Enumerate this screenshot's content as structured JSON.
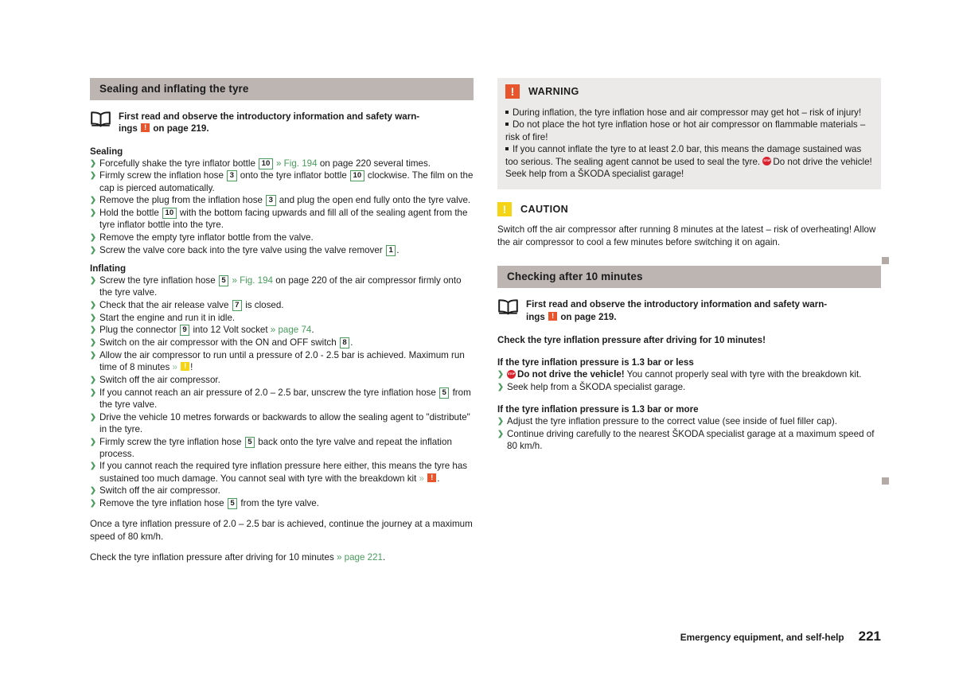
{
  "left_column": {
    "section_title": "Sealing and inflating the tyre",
    "read_first": {
      "line1": "First read and observe the introductory information and safety warn-",
      "line2_a": "ings",
      "line2_b": "on page 219."
    },
    "sealing": {
      "heading": "Sealing",
      "steps": [
        {
          "parts": [
            {
              "t": "text",
              "v": "Forcefully shake the tyre inflator bottle "
            },
            {
              "t": "numbox",
              "v": "10"
            },
            {
              "t": "xref",
              "v": "» Fig. 194"
            },
            {
              "t": "text",
              "v": " on page 220 several times."
            }
          ]
        },
        {
          "parts": [
            {
              "t": "text",
              "v": "Firmly screw the inflation hose "
            },
            {
              "t": "numbox",
              "v": "3"
            },
            {
              "t": "text",
              "v": " onto the tyre inflator bottle "
            },
            {
              "t": "numbox",
              "v": "10"
            },
            {
              "t": "text",
              "v": " clockwise. The film on the cap is pierced automatically."
            }
          ]
        },
        {
          "parts": [
            {
              "t": "text",
              "v": "Remove the plug from the inflation hose "
            },
            {
              "t": "numbox",
              "v": "3"
            },
            {
              "t": "text",
              "v": " and plug the open end fully onto the tyre valve."
            }
          ]
        },
        {
          "parts": [
            {
              "t": "text",
              "v": "Hold the bottle "
            },
            {
              "t": "numbox",
              "v": "10"
            },
            {
              "t": "text",
              "v": " with the bottom facing upwards and fill all of the sealing agent from the tyre inflator bottle into the tyre."
            }
          ]
        },
        {
          "parts": [
            {
              "t": "text",
              "v": "Remove the empty tyre inflator bottle from the valve."
            }
          ]
        },
        {
          "parts": [
            {
              "t": "text",
              "v": "Screw the valve core back into the tyre valve using the valve remover "
            },
            {
              "t": "numbox",
              "v": "1"
            },
            {
              "t": "text",
              "v": "."
            }
          ]
        }
      ]
    },
    "inflating": {
      "heading": "Inflating",
      "steps": [
        {
          "parts": [
            {
              "t": "text",
              "v": "Screw the tyre inflation hose "
            },
            {
              "t": "numbox",
              "v": "5"
            },
            {
              "t": "xref",
              "v": "» Fig. 194"
            },
            {
              "t": "text",
              "v": " on page 220 of the air compressor firmly onto the tyre valve."
            }
          ]
        },
        {
          "parts": [
            {
              "t": "text",
              "v": "Check that the air release valve "
            },
            {
              "t": "numbox",
              "v": "7"
            },
            {
              "t": "text",
              "v": " is closed."
            }
          ]
        },
        {
          "parts": [
            {
              "t": "text",
              "v": "Start the engine and run it in idle."
            }
          ]
        },
        {
          "parts": [
            {
              "t": "text",
              "v": "Plug the connector "
            },
            {
              "t": "numbox",
              "v": "9"
            },
            {
              "t": "text",
              "v": " into 12 Volt socket "
            },
            {
              "t": "xref",
              "v": "» page 74"
            },
            {
              "t": "text",
              "v": "."
            }
          ]
        },
        {
          "parts": [
            {
              "t": "text",
              "v": "Switch on the air compressor with the ON and OFF switch "
            },
            {
              "t": "numbox",
              "v": "8"
            },
            {
              "t": "text",
              "v": "."
            }
          ]
        },
        {
          "parts": [
            {
              "t": "text",
              "v": "Allow the air compressor to run until a pressure of 2.0 - 2.5 bar is achieved. Maximum run time of 8 minutes "
            },
            {
              "t": "xref-arrow",
              "v": "»"
            },
            {
              "t": "glyph-caution"
            },
            {
              "t": "text",
              "v": "!"
            }
          ]
        },
        {
          "parts": [
            {
              "t": "text",
              "v": "Switch off the air compressor."
            }
          ]
        },
        {
          "parts": [
            {
              "t": "text",
              "v": "If you cannot reach an air pressure of 2.0 – 2.5 bar, unscrew the tyre inflation hose "
            },
            {
              "t": "numbox",
              "v": "5"
            },
            {
              "t": "text",
              "v": " from the tyre valve."
            }
          ]
        },
        {
          "parts": [
            {
              "t": "text",
              "v": "Drive the vehicle 10 metres forwards or backwards to allow the sealing agent to \"distribute\" in the tyre."
            }
          ]
        },
        {
          "parts": [
            {
              "t": "text",
              "v": "Firmly screw the tyre inflation hose "
            },
            {
              "t": "numbox",
              "v": "5"
            },
            {
              "t": "text",
              "v": " back onto the tyre valve and repeat the inflation process."
            }
          ]
        },
        {
          "parts": [
            {
              "t": "text",
              "v": "If you cannot reach the required tyre inflation pressure here either, this means the tyre has sustained too much damage. You cannot seal with tyre with the breakdown kit "
            },
            {
              "t": "xref-arrow",
              "v": "»"
            },
            {
              "t": "glyph-warn"
            },
            {
              "t": "text",
              "v": "."
            }
          ]
        },
        {
          "parts": [
            {
              "t": "text",
              "v": "Switch off the air compressor."
            }
          ]
        },
        {
          "parts": [
            {
              "t": "text",
              "v": "Remove the tyre inflation hose "
            },
            {
              "t": "numbox",
              "v": "5"
            },
            {
              "t": "text",
              "v": " from the tyre valve."
            }
          ]
        }
      ]
    },
    "closing_para_1": "Once a tyre inflation pressure of 2.0 – 2.5 bar is achieved, continue the journey at a maximum speed of 80 km/h.",
    "closing_para_2": {
      "text": "Check the tyre inflation pressure after driving for 10 minutes ",
      "xref": "» page 221",
      "tail": "."
    }
  },
  "right_column": {
    "warning": {
      "title": "WARNING",
      "items": [
        "During inflation, the tyre inflation hose and air compressor may get hot – risk of injury!",
        "Do not place the hot tyre inflation hose or hot air compressor on flammable materials – risk of fire!",
        "If you cannot inflate the tyre to at least 2.0 bar, this means the damage sustained was too serious. The sealing agent cannot be used to seal the tyre."
      ],
      "stop_tail": "Do not drive the vehicle! Seek help from a ŠKODA specialist garage!"
    },
    "caution": {
      "title": "CAUTION",
      "body": "Switch off the air compressor after running 8 minutes at the latest – risk of overheating! Allow the air compressor to cool a few minutes before switching it on again."
    },
    "section_title": "Checking after 10 minutes",
    "read_first": {
      "line1": "First read and observe the introductory information and safety warn-",
      "line2_a": "ings",
      "line2_b": "on page 219."
    },
    "check_lead": "Check the tyre inflation pressure after driving for 10 minutes!",
    "case_low": {
      "heading": "If the tyre inflation pressure is 1.3 bar or less",
      "steps": [
        {
          "parts": [
            {
              "t": "glyph-stop"
            },
            {
              "t": "bold",
              "v": "Do not drive the vehicle!"
            },
            {
              "t": "text",
              "v": " You cannot properly seal with tyre with the breakdown kit."
            }
          ]
        },
        {
          "parts": [
            {
              "t": "text",
              "v": "Seek help from a ŠKODA specialist garage."
            }
          ]
        }
      ]
    },
    "case_high": {
      "heading": "If the tyre inflation pressure is 1.3 bar or more",
      "steps": [
        {
          "parts": [
            {
              "t": "text",
              "v": "Adjust the tyre inflation pressure to the correct value (see inside of fuel filler cap)."
            }
          ]
        },
        {
          "parts": [
            {
              "t": "text",
              "v": "Continue driving carefully to the nearest ŠKODA specialist garage at a maximum speed of 80 km/h."
            }
          ]
        }
      ]
    }
  },
  "footer": {
    "title": "Emergency equipment, and self-help",
    "page": "221"
  },
  "colors": {
    "section_bar": "#bcb5b2",
    "admonition_bg": "#eceae8",
    "warning_orange": "#e8552d",
    "caution_yellow": "#f5d416",
    "stop_red": "#d8232f",
    "xref_green": "#4a9b5d",
    "margin_marker": "#b3aaa6",
    "text": "#1c1c1c"
  }
}
